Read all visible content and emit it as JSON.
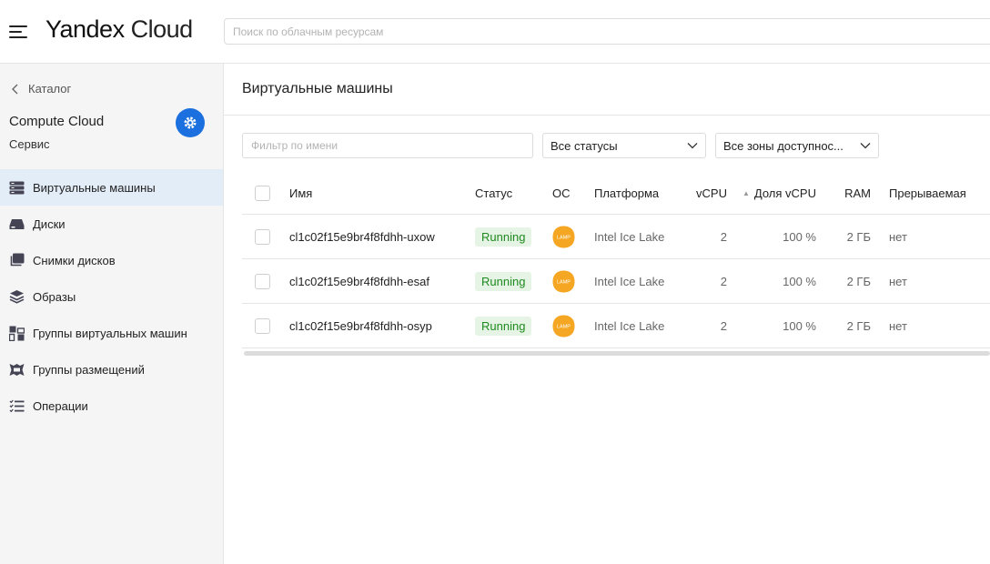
{
  "header": {
    "logo_bold": "Yandex",
    "logo_light": "Cloud",
    "search_placeholder": "Поиск по облачным ресурсам"
  },
  "sidebar": {
    "back_label": "Каталог",
    "service_title": "Compute Cloud",
    "service_subtitle": "Сервис",
    "items": [
      {
        "label": "Виртуальные машины",
        "icon": "server-icon",
        "active": true
      },
      {
        "label": "Диски",
        "icon": "disk-icon",
        "active": false
      },
      {
        "label": "Снимки дисков",
        "icon": "snapshot-icon",
        "active": false
      },
      {
        "label": "Образы",
        "icon": "layers-icon",
        "active": false
      },
      {
        "label": "Группы виртуальных машин",
        "icon": "group-icon",
        "active": false
      },
      {
        "label": "Группы размещений",
        "icon": "placement-icon",
        "active": false
      },
      {
        "label": "Операции",
        "icon": "list-icon",
        "active": false
      }
    ]
  },
  "main": {
    "title": "Виртуальные машины",
    "filter_placeholder": "Фильтр по имени",
    "status_select": "Все статусы",
    "zone_select": "Все зоны доступнос...",
    "columns": {
      "name": "Имя",
      "status": "Статус",
      "os": "ОС",
      "platform": "Платформа",
      "vcpu": "vCPU",
      "share": "Доля vCPU",
      "ram": "RAM",
      "interruptible": "Прерываемая"
    },
    "rows": [
      {
        "name": "cl1c02f15e9br4f8fdhh-uxow",
        "status": "Running",
        "os": "LAMP",
        "platform": "Intel Ice Lake",
        "vcpu": "2",
        "share": "100 %",
        "ram": "2 ГБ",
        "interruptible": "нет"
      },
      {
        "name": "cl1c02f15e9br4f8fdhh-esaf",
        "status": "Running",
        "os": "LAMP",
        "platform": "Intel Ice Lake",
        "vcpu": "2",
        "share": "100 %",
        "ram": "2 ГБ",
        "interruptible": "нет"
      },
      {
        "name": "cl1c02f15e9br4f8fdhh-osyp",
        "status": "Running",
        "os": "LAMP",
        "platform": "Intel Ice Lake",
        "vcpu": "2",
        "share": "100 %",
        "ram": "2 ГБ",
        "interruptible": "нет"
      }
    ]
  },
  "colors": {
    "accent": "#1b6fde",
    "active_nav": "#e3edf8",
    "status_running_bg": "#e6f4e6",
    "status_running_text": "#1f8a1f",
    "os_icon": "#f5a623"
  }
}
